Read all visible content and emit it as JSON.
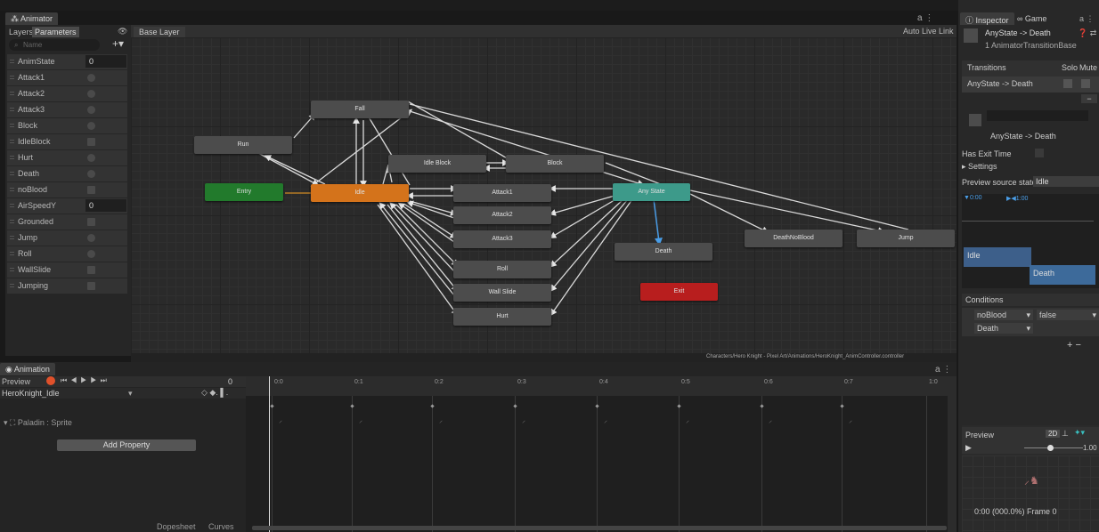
{
  "animator": {
    "tab": "Animator",
    "layers_tab": "Layers",
    "parameters_tab": "Parameters",
    "base_layer": "Base Layer",
    "auto_live_link": "Auto Live Link",
    "search_placeholder": "Name",
    "path": "Characters/Hero Knight - Pixel Art/Animations/HeroKnight_AnimController.controller",
    "parameters": [
      {
        "name": "AnimState",
        "type": "int",
        "value": "0"
      },
      {
        "name": "Attack1",
        "type": "trigger"
      },
      {
        "name": "Attack2",
        "type": "trigger"
      },
      {
        "name": "Attack3",
        "type": "trigger"
      },
      {
        "name": "Block",
        "type": "trigger"
      },
      {
        "name": "IdleBlock",
        "type": "bool"
      },
      {
        "name": "Hurt",
        "type": "trigger"
      },
      {
        "name": "Death",
        "type": "trigger"
      },
      {
        "name": "noBlood",
        "type": "bool"
      },
      {
        "name": "AirSpeedY",
        "type": "float",
        "value": "0"
      },
      {
        "name": "Grounded",
        "type": "bool"
      },
      {
        "name": "Jump",
        "type": "trigger"
      },
      {
        "name": "Roll",
        "type": "trigger"
      },
      {
        "name": "WallSlide",
        "type": "bool"
      },
      {
        "name": "Jumping",
        "type": "bool"
      }
    ],
    "states": {
      "fall": "Fall",
      "run": "Run",
      "idle_block": "Idle Block",
      "block": "Block",
      "entry": "Entry",
      "idle": "Idle",
      "attack1": "Attack1",
      "any_state": "Any State",
      "attack2": "Attack2",
      "attack3": "Attack3",
      "death_no_blood": "DeathNoBlood",
      "jump": "Jump",
      "death": "Death",
      "roll": "Roll",
      "exit": "Exit",
      "wall_slide": "Wall Slide",
      "hurt": "Hurt"
    }
  },
  "animation": {
    "tab": "Animation",
    "preview": "Preview",
    "frame": "0",
    "clip": "HeroKnight_Idle",
    "track": "Paladin : Sprite",
    "add_property": "Add Property",
    "dopesheet": "Dopesheet",
    "curves": "Curves",
    "ticks": [
      "0:0",
      "0:1",
      "0:2",
      "0:3",
      "0:4",
      "0:5",
      "0:6",
      "0:7",
      "1:0"
    ]
  },
  "inspector": {
    "tab": "Inspector",
    "game_tab": "Game",
    "title": "AnyState -> Death",
    "subtitle": "1 AnimatorTransitionBase",
    "transitions_label": "Transitions",
    "solo": "Solo",
    "mute": "Mute",
    "transition_item": "AnyState -> Death",
    "transition_name": "AnyState -> Death",
    "has_exit_time": "Has Exit Time",
    "settings": "Settings",
    "preview_source_label": "Preview source state",
    "preview_source_value": "Idle",
    "timeline_labels": [
      "0:00",
      "1:00"
    ],
    "bar_idle": "Idle",
    "bar_death": "Death",
    "conditions": "Conditions",
    "condition_param": "noBlood",
    "condition_value": "false",
    "condition_param2": "Death",
    "preview": "Preview",
    "mode_2d": "2D",
    "speed": "1.00",
    "time_readout": "0:00 (000.0%) Frame 0"
  }
}
